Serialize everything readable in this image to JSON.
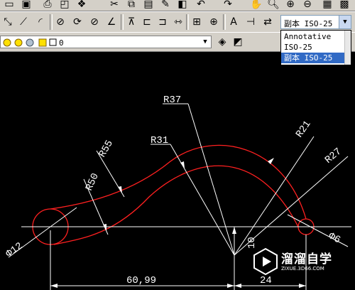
{
  "dimstyle": {
    "selected": "副本 ISO-25",
    "options": [
      "Annotative",
      "ISO-25",
      "副本 ISO-25"
    ]
  },
  "layer": {
    "current": "0"
  },
  "drawing": {
    "labels": {
      "r37": "R37",
      "r31": "R31",
      "r55": "R55",
      "r50": "R50",
      "r21": "R21",
      "r27": "R27",
      "d12": "Φ12",
      "d6": "Φ6",
      "dim_6099": "60,99",
      "dim_10": "10",
      "dim_24": "24"
    }
  },
  "watermark": {
    "title": "溜溜自学",
    "url": "ZIXUE.3D66.COM"
  },
  "colors": {
    "background": "#000000",
    "geometry": "#ff2020",
    "dimension": "#ffffff",
    "toolbar": "#d4d0c8",
    "selection": "#316ac5"
  }
}
